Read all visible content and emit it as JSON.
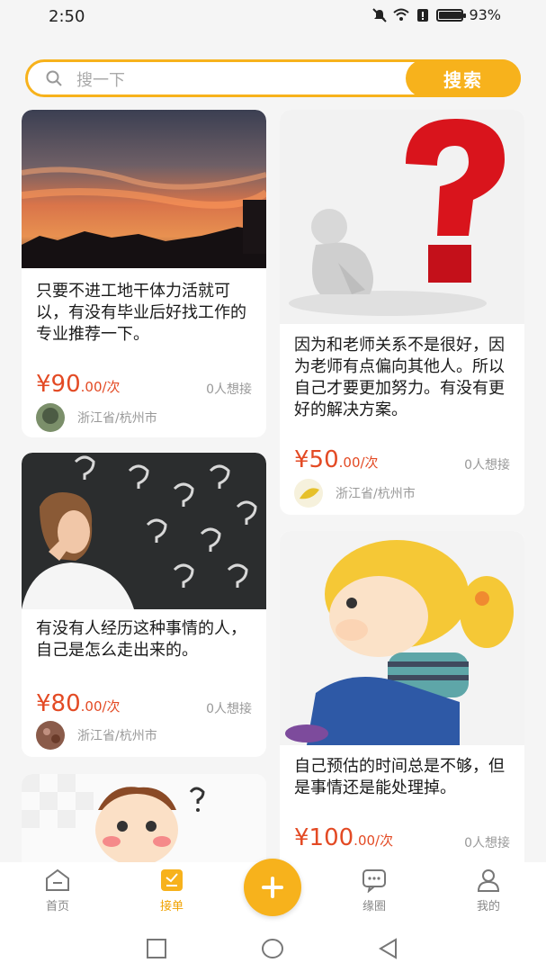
{
  "status_bar": {
    "time": "2:50",
    "battery": "93%",
    "battery_level": 0.93
  },
  "search": {
    "placeholder": "搜一下",
    "button_label": "搜索"
  },
  "posts": [
    {
      "title": "只要不进工地干体力活就可以，有没有毕业后好找工作的专业推荐一下。",
      "price": "¥90",
      "price_unit": ".00/次",
      "want": "0人想接",
      "location": "浙江省/杭州市"
    },
    {
      "title": "因为和老师关系不是很好，因为老师有点偏向其他人。所以自己才要更加努力。有没有更好的解决方案。",
      "price": "¥50",
      "price_unit": ".00/次",
      "want": "0人想接",
      "location": "浙江省/杭州市"
    },
    {
      "title": "有没有人经历这种事情的人，自己是怎么走出来的。",
      "price": "¥80",
      "price_unit": ".00/次",
      "want": "0人想接",
      "location": "浙江省/杭州市"
    },
    {
      "title": "自己预估的时间总是不够，但是事情还是能处理掉。",
      "price": "¥100",
      "price_unit": ".00/次",
      "want": "0人想接"
    }
  ],
  "nav": [
    {
      "label": "首页"
    },
    {
      "label": "接单"
    },
    {
      "label": "缘圈"
    },
    {
      "label": "我的"
    }
  ],
  "colors": {
    "accent": "#f7b21c",
    "price": "#e34a24"
  }
}
